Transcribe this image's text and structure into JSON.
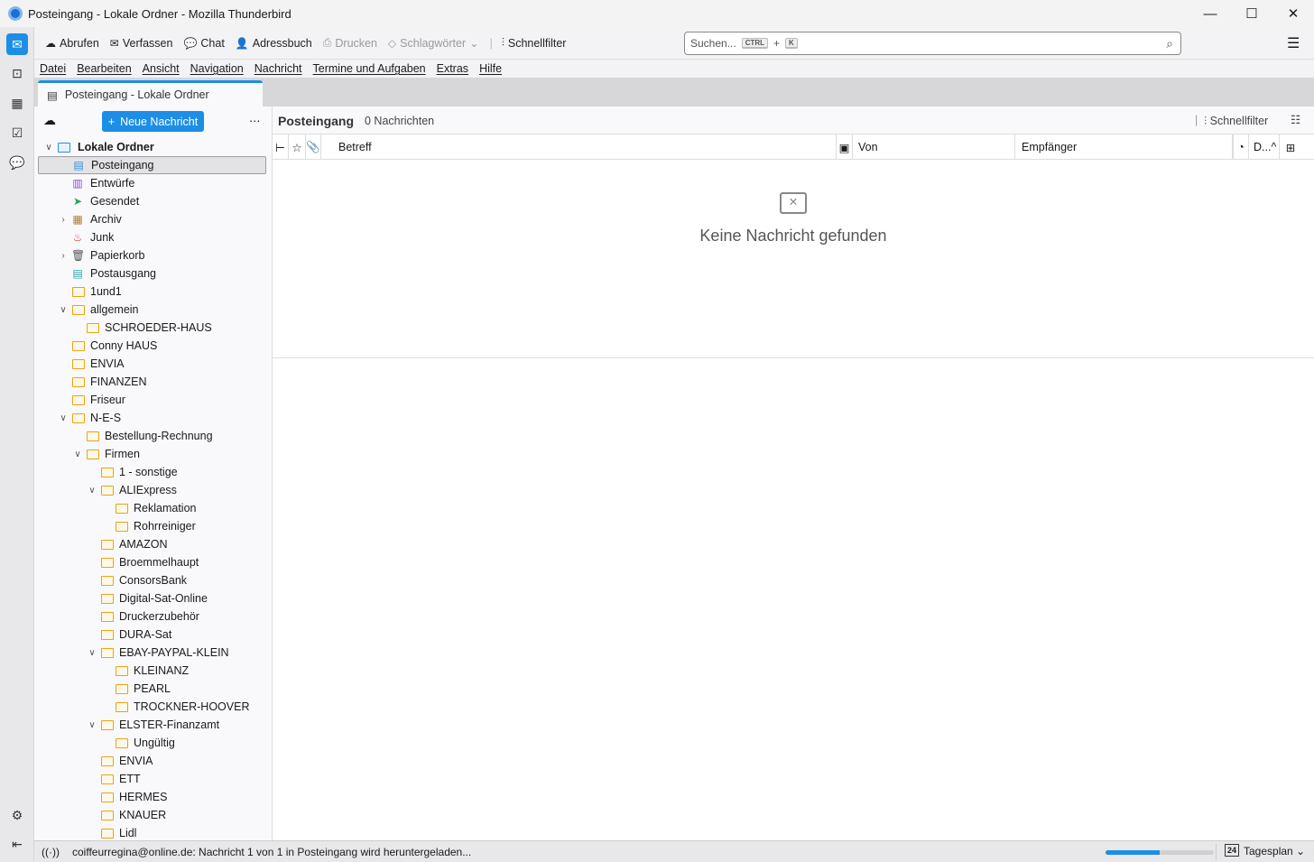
{
  "window": {
    "title": "Posteingang - Lokale Ordner - Mozilla Thunderbird"
  },
  "toolbar": {
    "items": [
      {
        "label": "Abrufen",
        "icon": "get-messages-icon",
        "disabled": false,
        "glyph": "☁"
      },
      {
        "label": "Verfassen",
        "icon": "compose-icon",
        "disabled": false,
        "glyph": "✉"
      },
      {
        "label": "Chat",
        "icon": "chat-icon",
        "disabled": false,
        "glyph": "💬"
      },
      {
        "label": "Adressbuch",
        "icon": "address-book-icon",
        "disabled": false,
        "glyph": "👤"
      },
      {
        "label": "Drucken",
        "icon": "print-icon",
        "disabled": true,
        "glyph": "⎙"
      },
      {
        "label": "Schlagwörter",
        "icon": "tag-icon",
        "disabled": true,
        "glyph": "◇"
      },
      {
        "label": "Schnellfilter",
        "icon": "quick-filter-icon",
        "disabled": false,
        "glyph": "⫶"
      }
    ],
    "search_placeholder": "Suchen...",
    "search_key1": "CTRL",
    "search_plus": "+",
    "search_key2": "K"
  },
  "menubar": [
    "Datei",
    "Bearbeiten",
    "Ansicht",
    "Navigation",
    "Nachricht",
    "Termine und Aufgaben",
    "Extras",
    "Hilfe"
  ],
  "tab": {
    "label": "Posteingang - Lokale Ordner"
  },
  "folderpane": {
    "new_message": "Neue Nachricht",
    "more": "⋯",
    "folders": [
      {
        "label": "Lokale Ordner",
        "level": 0,
        "state": "open",
        "type": "account"
      },
      {
        "label": "Posteingang",
        "level": 1,
        "type": "inbox",
        "selected": true
      },
      {
        "label": "Entwürfe",
        "level": 1,
        "type": "drafts"
      },
      {
        "label": "Gesendet",
        "level": 1,
        "type": "sent"
      },
      {
        "label": "Archiv",
        "level": 1,
        "state": "closed",
        "type": "archive"
      },
      {
        "label": "Junk",
        "level": 1,
        "type": "junk"
      },
      {
        "label": "Papierkorb",
        "level": 1,
        "state": "closed",
        "type": "trash"
      },
      {
        "label": "Postausgang",
        "level": 1,
        "type": "outbox"
      },
      {
        "label": "1und1",
        "level": 1
      },
      {
        "label": "allgemein",
        "level": 1,
        "state": "open"
      },
      {
        "label": "SCHROEDER-HAUS",
        "level": 2
      },
      {
        "label": "Conny HAUS",
        "level": 1
      },
      {
        "label": "ENVIA",
        "level": 1
      },
      {
        "label": "FINANZEN",
        "level": 1
      },
      {
        "label": "Friseur",
        "level": 1
      },
      {
        "label": "N-E-S",
        "level": 1,
        "state": "open"
      },
      {
        "label": "Bestellung-Rechnung",
        "level": 2
      },
      {
        "label": "Firmen",
        "level": 2,
        "state": "open"
      },
      {
        "label": "1 - sonstige",
        "level": 3
      },
      {
        "label": "ALIExpress",
        "level": 3,
        "state": "open"
      },
      {
        "label": "Reklamation",
        "level": 4
      },
      {
        "label": "Rohrreiniger",
        "level": 4
      },
      {
        "label": "AMAZON",
        "level": 3
      },
      {
        "label": "Broemmelhaupt",
        "level": 3
      },
      {
        "label": "ConsorsBank",
        "level": 3
      },
      {
        "label": "Digital-Sat-Online",
        "level": 3
      },
      {
        "label": "Druckerzubehör",
        "level": 3
      },
      {
        "label": "DURA-Sat",
        "level": 3
      },
      {
        "label": "EBAY-PAYPAL-KLEIN",
        "level": 3,
        "state": "open"
      },
      {
        "label": "KLEINANZ",
        "level": 4
      },
      {
        "label": "PEARL",
        "level": 4
      },
      {
        "label": "TROCKNER-HOOVER",
        "level": 4
      },
      {
        "label": "ELSTER-Finanzamt",
        "level": 3,
        "state": "open"
      },
      {
        "label": "Ungültig",
        "level": 4
      },
      {
        "label": "ENVIA",
        "level": 3
      },
      {
        "label": "ETT",
        "level": 3
      },
      {
        "label": "HERMES",
        "level": 3
      },
      {
        "label": "KNAUER",
        "level": 3
      },
      {
        "label": "Lidl",
        "level": 3
      }
    ]
  },
  "messages": {
    "folder_name": "Posteingang",
    "count": "0 Nachrichten",
    "quick_filter": "Schnellfilter",
    "columns": {
      "subject": "Betreff",
      "from": "Von",
      "recipient": "Empfänger",
      "date": "D..."
    },
    "empty_text": "Keine Nachricht gefunden"
  },
  "statusbar": {
    "text": "coiffeurregina@online.de: Nachricht 1 von 1 in Posteingang wird heruntergeladen...",
    "progress": 0.5,
    "today_pane": "Tagesplan",
    "today_day": "24"
  },
  "colors": {
    "accent": "#1c8ee6",
    "folder": "#e8a317"
  }
}
